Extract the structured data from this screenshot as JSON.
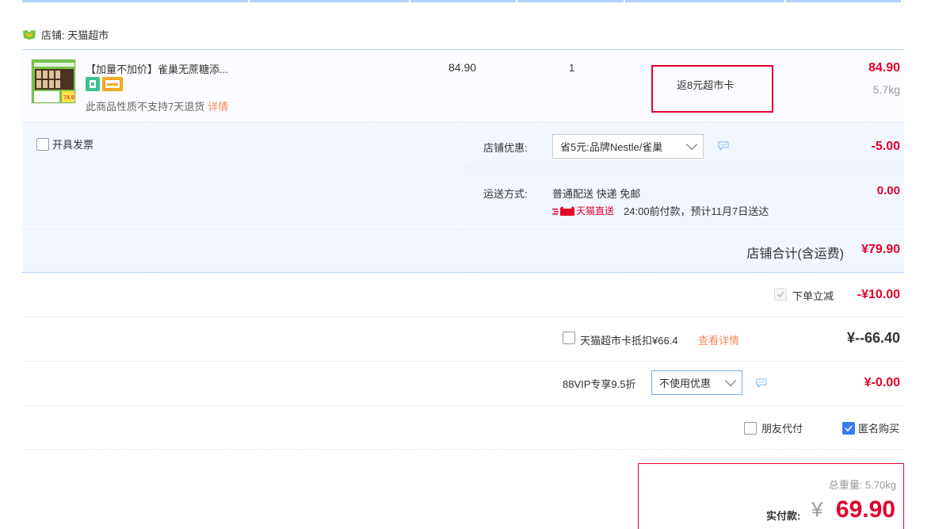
{
  "shop": {
    "name": "店铺: 天猫超市"
  },
  "item": {
    "title": "【加量不加价】雀巢无蔗糖添...",
    "no_return_text": "此商品性质不支持7天退货",
    "details_link": "详情",
    "unit_price": "84.90",
    "quantity": "1",
    "rebate": "返8元超市卡",
    "total": "84.90",
    "weight": "5.7kg",
    "thumb_price": "74.9"
  },
  "options": {
    "invoice_label": "开具发票",
    "shop_discount_label": "店铺优惠:",
    "shop_discount_value": "省5元:品牌Nestle/雀巢",
    "shop_discount_amount": "-5.00",
    "delivery_label": "运送方式:",
    "delivery_method": "普通配送 快递 免邮",
    "delivery_brand": "天猫直送",
    "delivery_eta": "24:00前付款，预计11月7日送达",
    "delivery_amount": "0.00"
  },
  "shop_total": {
    "label": "店铺合计(含运费)",
    "amount": "¥79.90"
  },
  "order_discount": {
    "label": "下单立减",
    "amount": "-¥10.00"
  },
  "supermarket_card": {
    "label": "天猫超市卡抵扣¥66.4",
    "link": "查看详情",
    "amount": "¥--66.40"
  },
  "vip": {
    "label": "88VIP专享9.5折",
    "select_value": "不使用优惠",
    "amount": "¥-0.00"
  },
  "extras": {
    "friend_pay": "朋友代付",
    "anonymous": "匿名购买"
  },
  "summary": {
    "total_weight": "总重量: 5.70kg",
    "pay_label": "实付款:",
    "currency": "¥",
    "pay_amount": "69.90"
  },
  "colors": {
    "accent_red": "#e4002b",
    "link_orange": "#f08c5a",
    "checkbox_blue": "#3a7bf0",
    "panel_blue": "#f2f7ff"
  }
}
